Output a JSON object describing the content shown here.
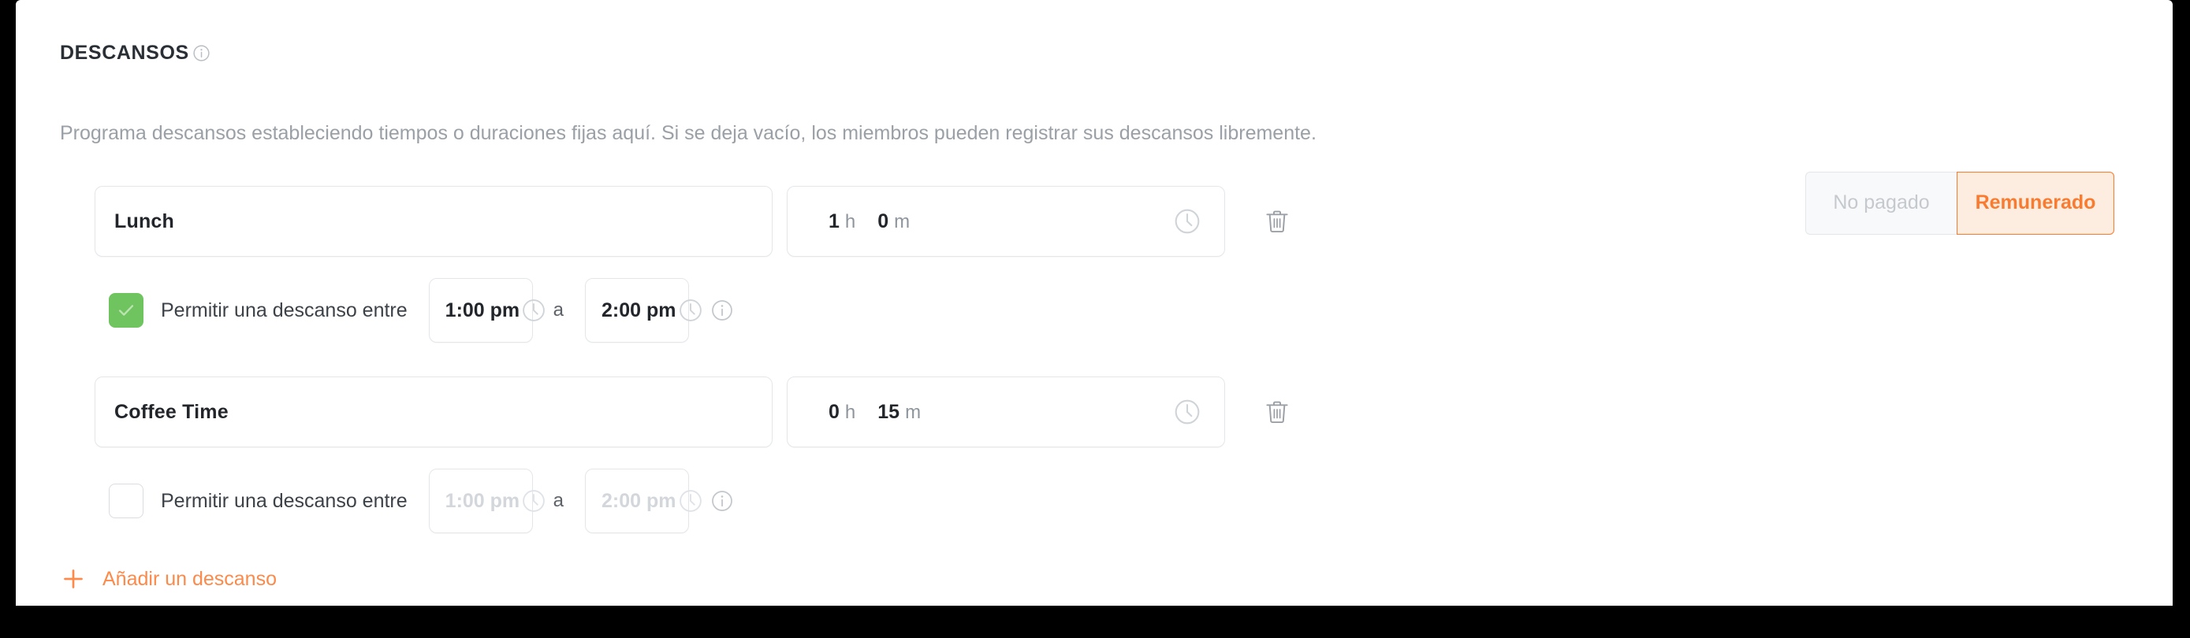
{
  "section": {
    "title": "DESCANSOS",
    "info_icon": "info-circle-icon",
    "description": "Programa descansos estableciendo tiempos o duraciones fijas aquí. Si se deja vacío, los miembros pueden registrar sus descansos libremente."
  },
  "colors": {
    "accent_orange": "#f97b2f",
    "add_link_orange": "#fb8a4b",
    "checkbox_green": "#6fc45f",
    "paid_selected_bg": "#fdece0",
    "unpaid_bg": "#f8f9fa",
    "border_gray": "#e4e7ea",
    "muted_text": "#9aa0a6",
    "value_text": "#22262b"
  },
  "breaks": [
    {
      "name_value": "Lunch",
      "name_placeholder": "",
      "duration": {
        "hours": "1",
        "hours_unit": "h",
        "minutes": "0",
        "minutes_unit": "m"
      },
      "duration_clock_icon": "clock-icon",
      "delete_icon": "trash-icon",
      "paid_toggle": {
        "unpaid_label": "No pagado",
        "paid_label": "Remunerado",
        "selected": "Remunerado"
      },
      "window": {
        "checked": true,
        "label": "Permitir una descanso entre",
        "start_value": "1:00 pm",
        "start_placeholder": "1:00 pm",
        "separator": "a",
        "end_value": "2:00 pm",
        "end_placeholder": "2:00 pm",
        "info_icon": "info-circle-icon",
        "clock_icon": "clock-icon"
      }
    },
    {
      "name_value": "Coffee Time",
      "name_placeholder": "",
      "duration": {
        "hours": "0",
        "hours_unit": "h",
        "minutes": "15",
        "minutes_unit": "m"
      },
      "duration_clock_icon": "clock-icon",
      "delete_icon": "trash-icon",
      "paid_toggle": null,
      "window": {
        "checked": false,
        "label": "Permitir una descanso entre",
        "start_value": "",
        "start_placeholder": "1:00 pm",
        "separator": "a",
        "end_value": "",
        "end_placeholder": "2:00 pm",
        "info_icon": "info-circle-icon",
        "clock_icon": "clock-icon"
      }
    }
  ],
  "add_break": {
    "icon": "plus-icon",
    "label": "Añadir un descanso"
  }
}
